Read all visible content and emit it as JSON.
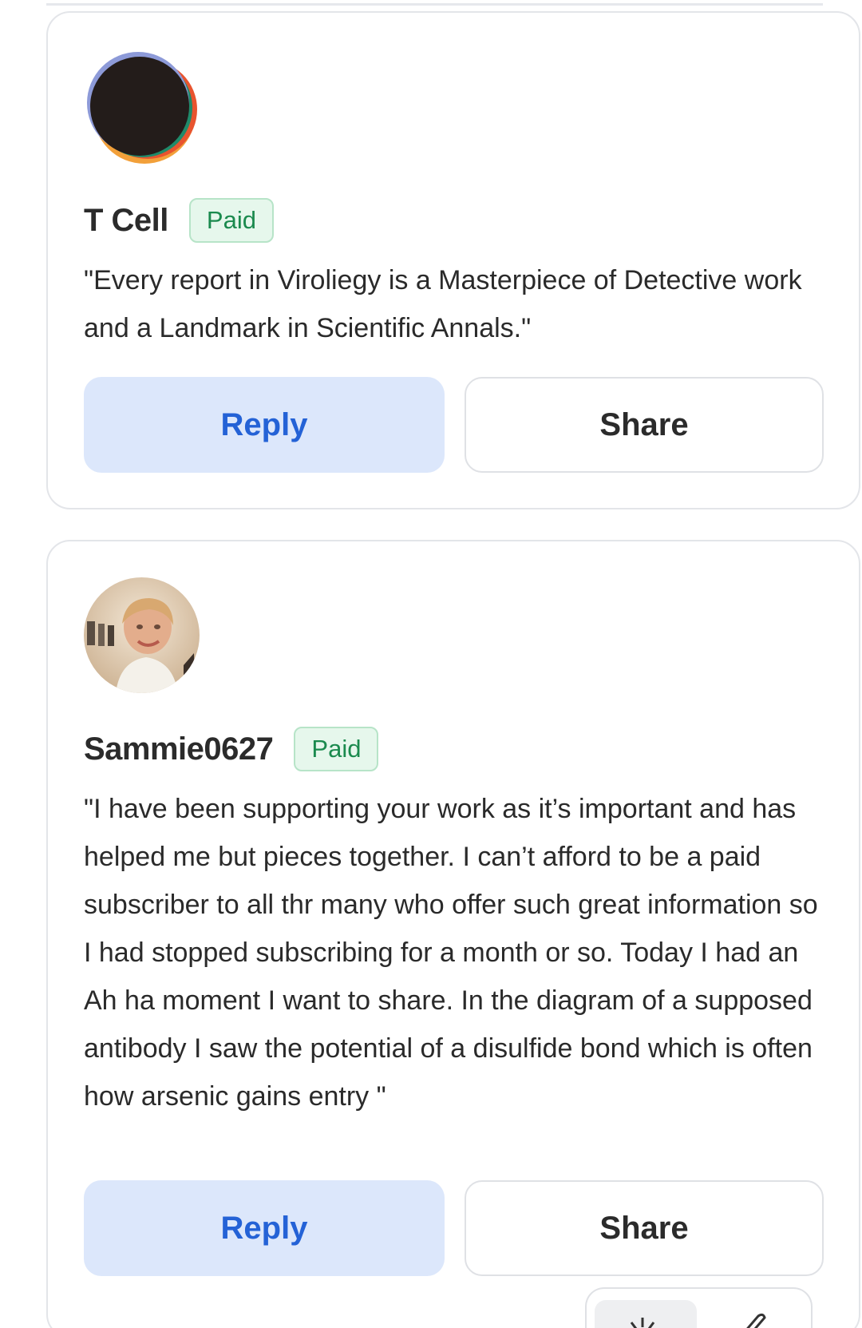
{
  "comments": [
    {
      "author": "T Cell",
      "badge": "Paid",
      "text": "\"Every report in Viroliegy is a Masterpiece of Detective work and a Landmark in Scientific Annals.\"",
      "reply_label": "Reply",
      "share_label": "Share"
    },
    {
      "author": "Sammie0627",
      "badge": "Paid",
      "text": "\"I have been supporting your work as it’s important and has helped me but pieces together. I can’t afford to be a paid subscriber to all thr many who offer such great information so I had stopped subscribing for a month or so. Today I had an Ah ha moment I want to share. In the diagram of a supposed antibody I saw the potential of a disulfide bond which is often how arsenic gains entry \"",
      "reply_label": "Reply",
      "share_label": "Share"
    }
  ],
  "colors": {
    "accent_blue": "#2462d6",
    "reply_bg": "#dce7fb",
    "paid_green": "#1b8a4e",
    "paid_bg": "#e6f7ec"
  },
  "icons": {
    "avatar_1": "abstract-logo-avatar",
    "avatar_2": "user-photo-avatar",
    "floating_a": "sparkle-icon",
    "floating_b": "pencil-icon"
  }
}
